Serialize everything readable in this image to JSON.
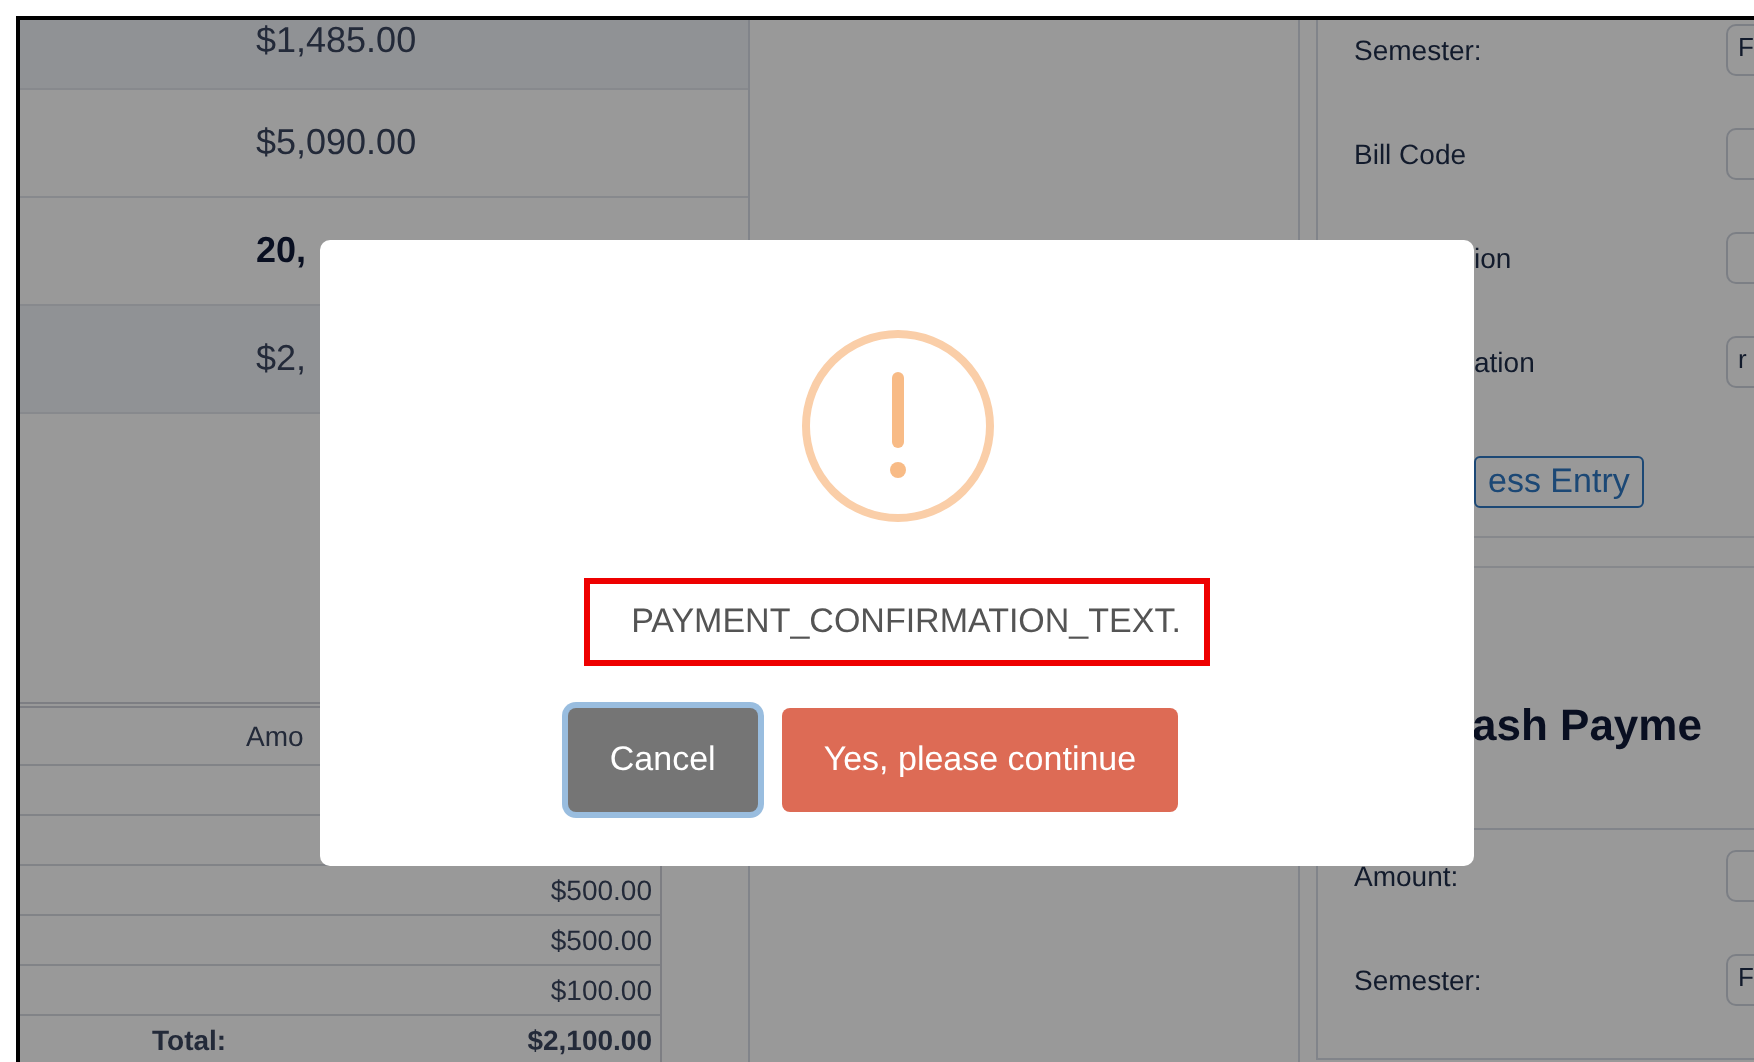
{
  "summary_table": {
    "rows": [
      {
        "amount": "$1,485.00",
        "bold": false
      },
      {
        "amount": "$5,090.00",
        "bold": false
      },
      {
        "amount": "20,",
        "bold": true
      },
      {
        "amount": "$2,",
        "bold": false
      }
    ]
  },
  "payments_table": {
    "header": "Amo",
    "rows": [
      {},
      {},
      {
        "amount": "$500.00"
      },
      {
        "amount": "$500.00"
      },
      {
        "amount": "$100.00"
      }
    ],
    "total_label": "Total:",
    "total": "$2,100.00"
  },
  "entry_form": {
    "fields": [
      {
        "kind": "full",
        "label": "Semester:",
        "value": "F"
      },
      {
        "kind": "full",
        "label": "Bill Code"
      },
      {
        "kind": "partial",
        "label": "ion"
      },
      {
        "kind": "partial",
        "label": "ation",
        "value": "r"
      }
    ],
    "submit_button": "ess Entry"
  },
  "cash_payment": {
    "heading": "ash Payme",
    "fields": [
      {
        "kind": "full",
        "label": "Amount:"
      },
      {
        "kind": "full",
        "label": "Semester:",
        "value": "F"
      }
    ]
  },
  "dialog": {
    "message": "PAYMENT_CONFIRMATION_TEXT.",
    "highlighted": true,
    "buttons": [
      {
        "kind": "cancel",
        "label": "Cancel",
        "focused": true
      },
      {
        "kind": "confirm",
        "label": "Yes, please continue",
        "focused": false
      }
    ]
  }
}
